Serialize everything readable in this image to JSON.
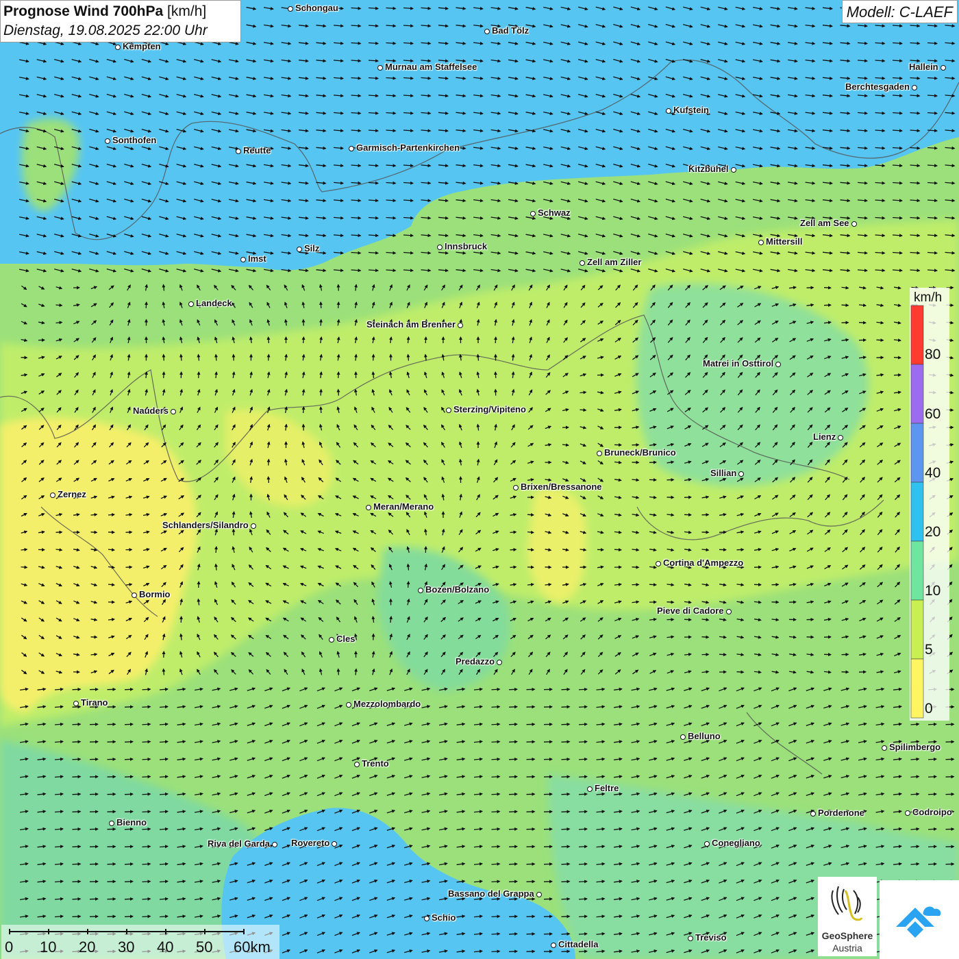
{
  "header": {
    "title_bold": "Prognose Wind 700hPa",
    "title_unit": "[km/h]",
    "datetime": "Dienstag, 19.08.2025 22:00 Uhr"
  },
  "model": {
    "label": "Modell: C-LAEF"
  },
  "legend": {
    "unit": "km/h",
    "labels": [
      "80",
      "60",
      "40",
      "20",
      "10",
      "5",
      "0"
    ],
    "colors": [
      "#ff3a2e",
      "#9b6cf0",
      "#5e95f0",
      "#2ec2f0",
      "#6fe6a0",
      "#c8f050",
      "#fff560"
    ]
  },
  "scale": {
    "labels": [
      "0",
      "10",
      "20",
      "30",
      "40",
      "50",
      "60km"
    ]
  },
  "logos": {
    "geosphere_line1": "GeoSphere",
    "geosphere_line2": "Austria"
  },
  "cities": [
    {
      "name": "Schongau"
    },
    {
      "name": "Bad Tölz"
    },
    {
      "name": "Kempten"
    },
    {
      "name": "Murnau am Staffelsee"
    },
    {
      "name": "Hallein"
    },
    {
      "name": "Berchtesgaden"
    },
    {
      "name": "Kufstein"
    },
    {
      "name": "Sonthofen"
    },
    {
      "name": "Reutte"
    },
    {
      "name": "Garmisch-Partenkirchen"
    },
    {
      "name": "Kitzbühel"
    },
    {
      "name": "Schwaz"
    },
    {
      "name": "Zell am See"
    },
    {
      "name": "Mittersill"
    },
    {
      "name": "Innsbruck"
    },
    {
      "name": "Silz"
    },
    {
      "name": "Imst"
    },
    {
      "name": "Zell am Ziller"
    },
    {
      "name": "Landeck"
    },
    {
      "name": "Steinach am Brenner"
    },
    {
      "name": "Matrei in Osttirol"
    },
    {
      "name": "Nauders"
    },
    {
      "name": "Sterzing/Vipiteno"
    },
    {
      "name": "Lienz"
    },
    {
      "name": "Bruneck/Brunico"
    },
    {
      "name": "Sillian"
    },
    {
      "name": "Brixen/Bressanone"
    },
    {
      "name": "Zernez"
    },
    {
      "name": "Meran/Merano"
    },
    {
      "name": "Schlanders/Silandro"
    },
    {
      "name": "Cortina d'Ampezzo"
    },
    {
      "name": "Bozen/Bolzano"
    },
    {
      "name": "Bormio"
    },
    {
      "name": "Pieve di Cadore"
    },
    {
      "name": "Cles"
    },
    {
      "name": "Predazzo"
    },
    {
      "name": "Tirano"
    },
    {
      "name": "Mezzolombardo"
    },
    {
      "name": "Belluno"
    },
    {
      "name": "Spilimbergo"
    },
    {
      "name": "Trento"
    },
    {
      "name": "Feltre"
    },
    {
      "name": "Pordenone"
    },
    {
      "name": "Codroipo"
    },
    {
      "name": "Bienno"
    },
    {
      "name": "Riva del Garda"
    },
    {
      "name": "Rovereto"
    },
    {
      "name": "Conegliano"
    },
    {
      "name": "Bassano del Grappa"
    },
    {
      "name": "Schio"
    },
    {
      "name": "Treviso"
    },
    {
      "name": "Cittadella"
    }
  ]
}
